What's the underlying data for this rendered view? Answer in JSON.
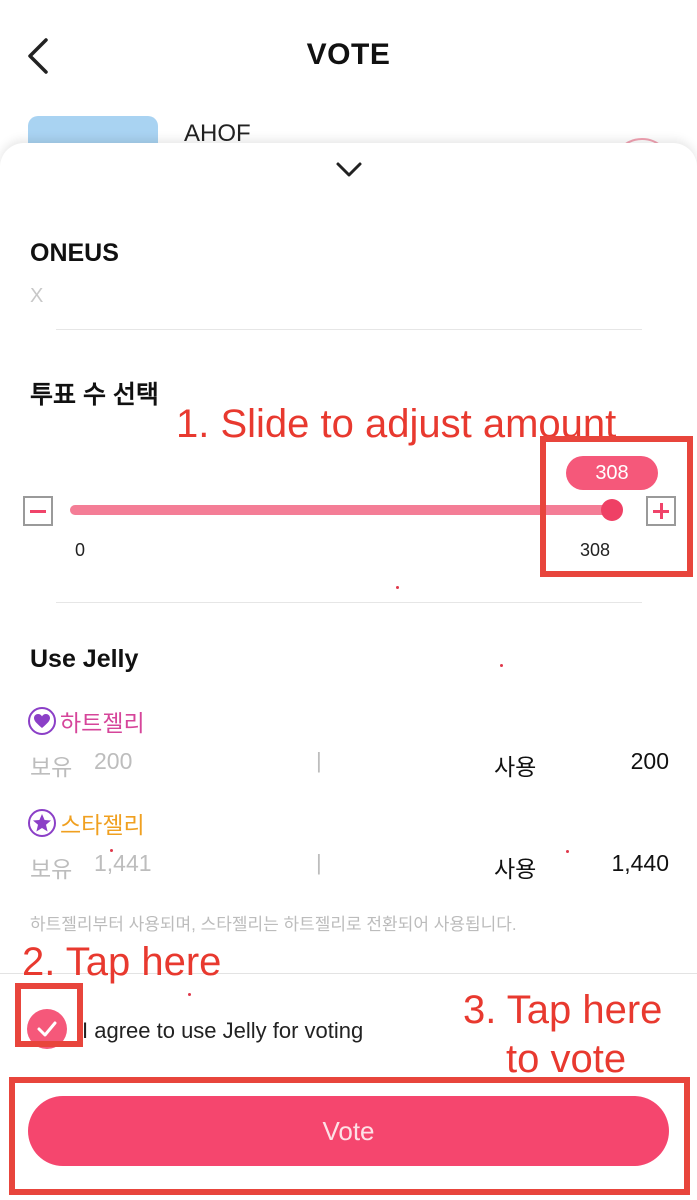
{
  "header": {
    "title": "VOTE",
    "back_icon": "chevron-left-icon"
  },
  "background_row": {
    "name": "AHOF"
  },
  "sheet": {
    "collapse_icon": "chevron-down-icon",
    "group_name": "ONEUS",
    "group_sub": "X",
    "vote_count_section": {
      "title": "투표 수 선택",
      "current_value": "308",
      "min_label": "0",
      "max_label": "308",
      "fill_fraction": 1.0,
      "minus_icon": "minus-icon",
      "plus_icon": "plus-icon"
    },
    "jelly_section": {
      "title": "Use Jelly",
      "heart_jelly": {
        "name": "하트젤리",
        "icon": "heart-jelly-icon",
        "color": "#d6459a",
        "held_label": "보유",
        "held_value": "200",
        "separator": "|",
        "use_label": "사용",
        "use_value": "200"
      },
      "star_jelly": {
        "name": "스타젤리",
        "icon": "star-jelly-icon",
        "color": "#f0a020",
        "held_label": "보유",
        "held_value": "1,441",
        "separator": "|",
        "use_label": "사용",
        "use_value": "1,440"
      },
      "notice": "하트젤리부터 사용되며, 스타젤리는 하트젤리로 전환되어 사용됩니다."
    },
    "agree": {
      "checked": true,
      "label": "I agree to use Jelly for voting"
    },
    "vote_button_label": "Vote"
  },
  "annotations": {
    "step1": "1. Slide to adjust amount",
    "step2": "2. Tap here",
    "step3_line1": "3. Tap here",
    "step3_line2": "to vote",
    "color": "#e8392f"
  },
  "colors": {
    "accent": "#f5466e",
    "slider_fill": "#f47d96",
    "jelly_purple": "#8b3fc7"
  }
}
